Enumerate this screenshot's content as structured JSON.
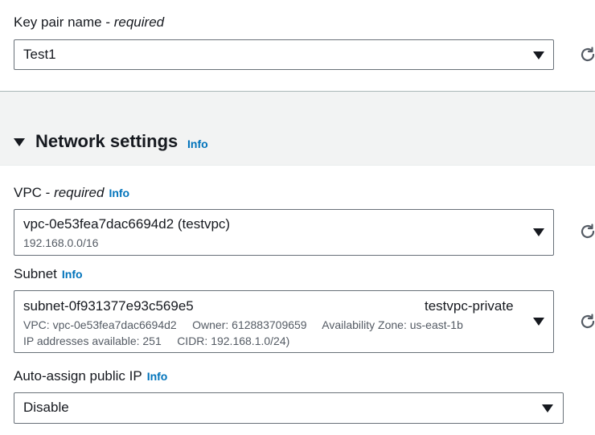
{
  "key_pair": {
    "label": "Key pair name - ",
    "required": "required",
    "value": "Test1"
  },
  "network": {
    "title": "Network settings",
    "info": "Info",
    "vpc": {
      "label": "VPC - ",
      "required": "required",
      "info": "Info",
      "value": "vpc-0e53fea7dac6694d2 (testvpc)",
      "cidr": "192.168.0.0/16"
    },
    "subnet": {
      "label": "Subnet",
      "info": "Info",
      "value": "subnet-0f931377e93c569e5",
      "name_tag": "testvpc-private",
      "details_line1": "VPC: vpc-0e53fea7dac6694d2     Owner: 612883709659     Availability Zone: us-east-1b",
      "details_line2": "IP addresses available: 251     CIDR: 192.168.1.0/24)"
    },
    "public_ip": {
      "label": "Auto-assign public IP",
      "info": "Info",
      "value": "Disable"
    }
  },
  "icons": {
    "refresh": "refresh-icon",
    "caret": "caret-down-icon",
    "expand": "expand-triangle-icon"
  }
}
